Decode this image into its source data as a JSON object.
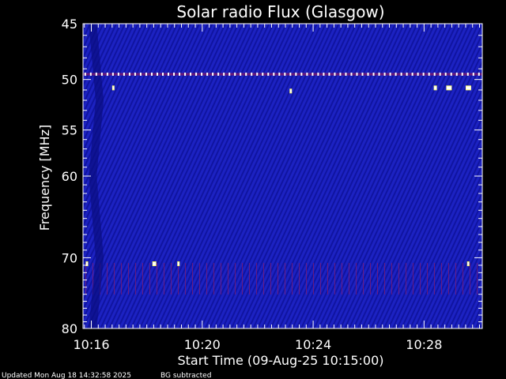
{
  "chart_data": {
    "type": "heatmap",
    "title": "Solar radio Flux (Glasgow)",
    "xlabel": "Start Time (09-Aug-25 10:15:00)",
    "ylabel": "Frequency [MHz]",
    "xlim_minutes": [
      15.7,
      30.1
    ],
    "ylim": [
      45,
      80
    ],
    "y_scale": "log",
    "x_ticks": [
      {
        "label": "10:16",
        "minute": 16
      },
      {
        "label": "10:20",
        "minute": 20
      },
      {
        "label": "10:24",
        "minute": 24
      },
      {
        "label": "10:28",
        "minute": 28
      }
    ],
    "y_ticks": [
      45,
      50,
      55,
      60,
      70,
      80
    ],
    "background_color": "#1a1fb8",
    "frame_color": "#ffffff",
    "features": [
      {
        "name": "narrowband line",
        "frequency_mhz": 49.5
      },
      {
        "name": "interference bursts",
        "frequency_mhz": 70.8
      },
      {
        "name": "broadband striations",
        "frequency_range_mhz": [
          73,
          78
        ]
      }
    ]
  },
  "footer": {
    "updated": "Updated Mon Aug 18 14:32:58 2025",
    "note": "BG subtracted"
  },
  "colors": {
    "background": "#000000",
    "spectrum": "#1a1fb8",
    "text": "#ffffff"
  }
}
